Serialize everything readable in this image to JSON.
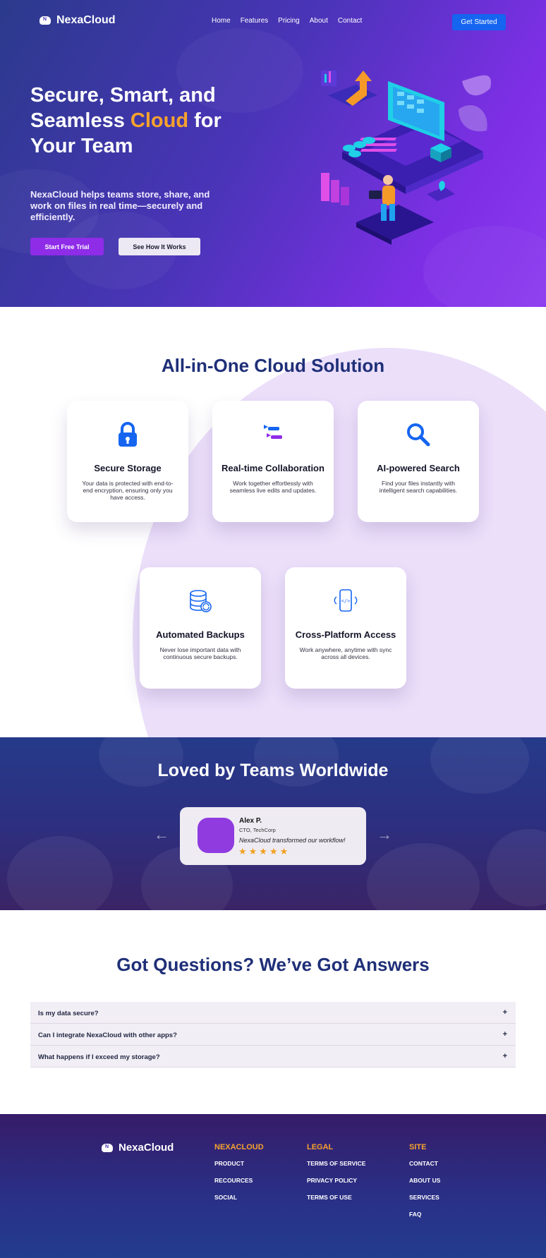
{
  "brand": {
    "name": "NexaCloud",
    "logo_letter": "N"
  },
  "nav": {
    "links": [
      "Home",
      "Features",
      "Pricing",
      "About",
      "Contact"
    ],
    "cta": "Get Started"
  },
  "hero": {
    "title_before": "Secure, Smart, and Seamless ",
    "title_accent": "Cloud",
    "title_after": " for Your Team",
    "subtitle": "NexaCloud helps teams store, share, and work on files in real time—securely and efficiently.",
    "primary_button": "Start Free Trial",
    "secondary_button": "See How It Works"
  },
  "features": {
    "title": "All-in-One Cloud Solution",
    "cards": [
      {
        "title": "Secure Storage",
        "desc": "Your data is protected with end-to-end encryption, ensuring only you have access.",
        "icon": "lock-icon"
      },
      {
        "title": "Real-time Collaboration",
        "desc": "Work together effortlessly with seamless live edits and updates.",
        "icon": "collaboration-icon"
      },
      {
        "title": "AI-powered Search",
        "desc": "Find your files instantly with intelligent search capabilities.",
        "icon": "search-icon"
      },
      {
        "title": "Automated Backups",
        "desc": "Never lose important data with continuous secure backups.",
        "icon": "database-backup-icon"
      },
      {
        "title": "Cross-Platform Access",
        "desc": "Work anywhere, anytime with sync across all devices.",
        "icon": "device-sync-icon"
      }
    ]
  },
  "testimonials": {
    "title": "Loved by Teams Worldwide",
    "items": [
      {
        "name": "Alex P.",
        "role": "CTO, TechCorp",
        "quote": "NexaCloud transformed our workflow!",
        "rating": 5,
        "stars": "★★★★★"
      }
    ],
    "prev_arrow": "←",
    "next_arrow": "→"
  },
  "faq": {
    "title": "Got Questions? We’ve Got Answers",
    "items": [
      {
        "question": "Is my data secure?",
        "toggle": "+"
      },
      {
        "question": "Can I integrate NexaCloud with other apps?",
        "toggle": "+"
      },
      {
        "question": "What happens if I exceed my storage?",
        "toggle": "+"
      }
    ]
  },
  "footer": {
    "columns": [
      {
        "heading": "NEXACLOUD",
        "links": [
          "PRODUCT",
          "RECOURCES",
          "SOCIAL"
        ]
      },
      {
        "heading": "LEGAL",
        "links": [
          "TERMS OF SERVICE",
          "PRIVACY POLICY",
          "TERMS OF USE"
        ]
      },
      {
        "heading": "SITE",
        "links": [
          "CONTACT",
          "ABOUT US",
          "SERVICES",
          "FAQ"
        ]
      }
    ]
  },
  "colors": {
    "accent_orange": "#f7a22d",
    "primary_purple": "#8e2ce8",
    "nav_blue": "#1565f0",
    "heading_navy": "#1f2f78"
  }
}
